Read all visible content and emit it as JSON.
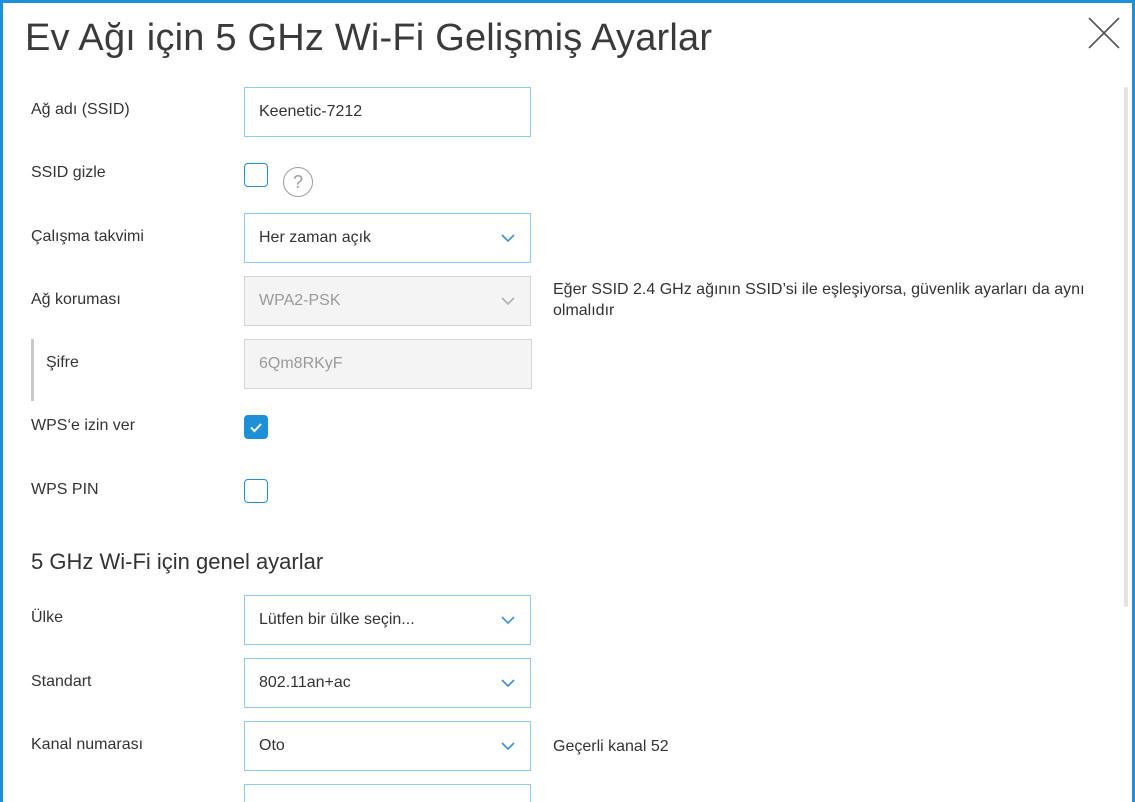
{
  "dialog": {
    "title": "Ev Ağı için 5 GHz Wi-Fi Gelişmiş Ayarlar"
  },
  "fields": {
    "ssid": {
      "label": "Ağ adı (SSID)",
      "value": "Keenetic-7212"
    },
    "hide_ssid": {
      "label": "SSID gizle",
      "checked": false,
      "help": "?"
    },
    "schedule": {
      "label": "Çalışma takvimi",
      "value": "Her zaman açık"
    },
    "security": {
      "label": "Ağ koruması",
      "value": "WPA2-PSK",
      "disabled": true,
      "hint": "Eğer SSID 2.4 GHz ağının SSID’si ile eşleşiyorsa, güvenlik ayarları da aynı olmalıdır"
    },
    "password": {
      "label": "Şifre",
      "value": "6Qm8RKyF",
      "disabled": true
    },
    "wps_allow": {
      "label": "WPS‘e izin ver",
      "checked": true
    },
    "wps_pin": {
      "label": "WPS PIN",
      "checked": false
    }
  },
  "general": {
    "heading": "5 GHz Wi-Fi için genel ayarlar",
    "country": {
      "label": "Ülke",
      "value": "Lütfen bir ülke seçin..."
    },
    "standard": {
      "label": "Standart",
      "value": "802.11an+ac"
    },
    "channel": {
      "label": "Kanal numarası",
      "value": "Oto",
      "hint": "Geçerli kanal 52"
    }
  },
  "colors": {
    "accent": "#1e90d8",
    "input_border": "#8dcbe9",
    "disabled_bg": "#f4f4f4"
  }
}
